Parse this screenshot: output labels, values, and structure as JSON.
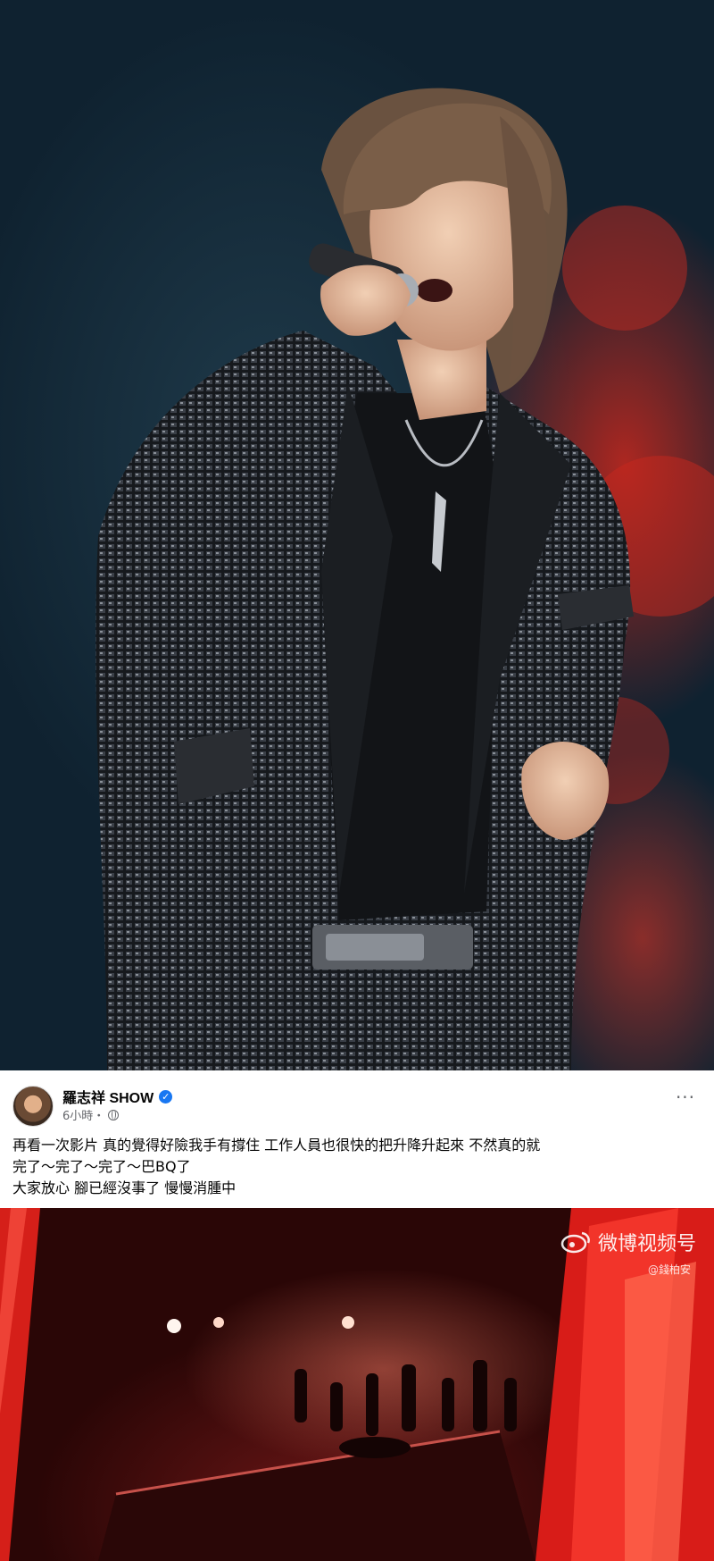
{
  "top_photo": {
    "kind": "concert-photo",
    "colors": {
      "background": "#14303c",
      "jacket": "#111418",
      "red_light": "#c8281e"
    }
  },
  "post": {
    "author_name": "羅志祥 SHOW",
    "timestamp": "6小時・",
    "verified": true,
    "more_label": "···",
    "text_lines": [
      "再看一次影片 真的覺得好險我手有撐住 工作人員也很快的把升降升起來 不然真的就",
      "完了～完了～完了～巴BQ了",
      "大家放心 腳已經沒事了 慢慢消腫中"
    ],
    "colors": {
      "verified": "#1877f2",
      "meta": "#65676b",
      "text": "#050505"
    }
  },
  "bottom_photo": {
    "kind": "stage-video-frame",
    "watermark": "微博视频号",
    "handle": "@錢柏安",
    "colors": {
      "stage": "#5a1212",
      "screen_red": "#e8221c"
    }
  }
}
